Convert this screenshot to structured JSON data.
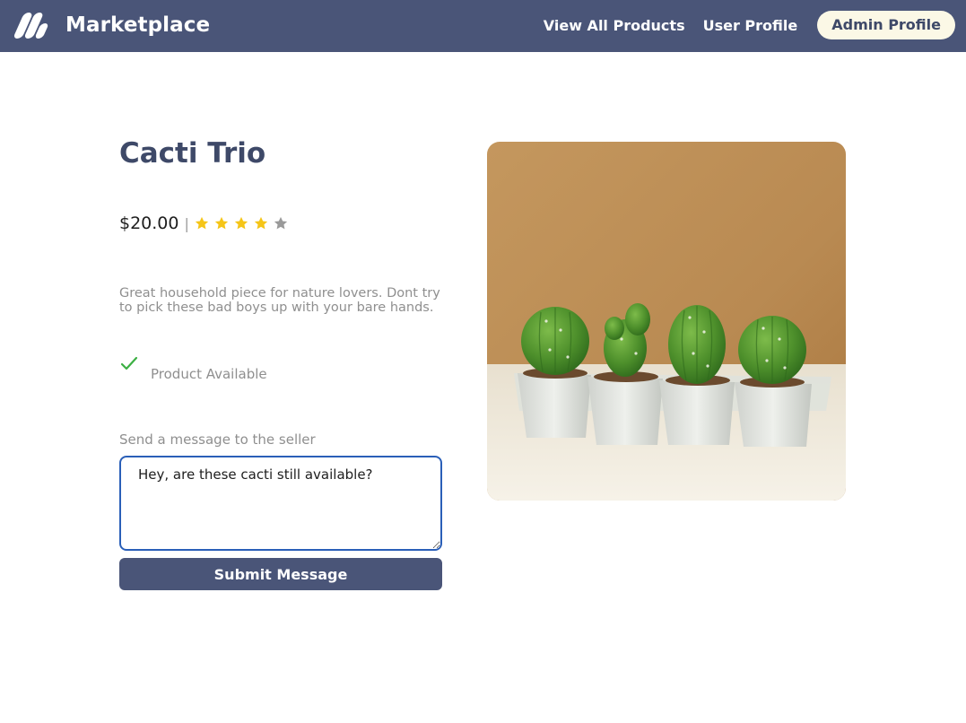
{
  "navbar": {
    "brand_name": "Marketplace",
    "links": {
      "view_all_products": "View All Products",
      "user_profile": "User Profile",
      "admin_profile": "Admin Profile"
    },
    "background_color": "#4a5578",
    "active_link_background": "#fbf8e6"
  },
  "product": {
    "title": "Cacti Trio",
    "price": "$20.00",
    "separator": "|",
    "rating": {
      "value": 4,
      "max": 5,
      "filled_color": "#f5c518",
      "empty_color": "#9a9a9a"
    },
    "description": "Great household piece for nature lovers. Dont try to pick these bad boys up with your bare hands.",
    "availability": "Product Available",
    "image_icon": "cacti-photo"
  },
  "message_form": {
    "label": "Send a message to the seller",
    "value": "Hey, are these cacti still available?",
    "submit_label": "Submit Message"
  },
  "colors": {
    "accent": "#4a5578",
    "title": "#3e4968",
    "check": "#3cb043",
    "focus_border": "#2a5fb8"
  }
}
